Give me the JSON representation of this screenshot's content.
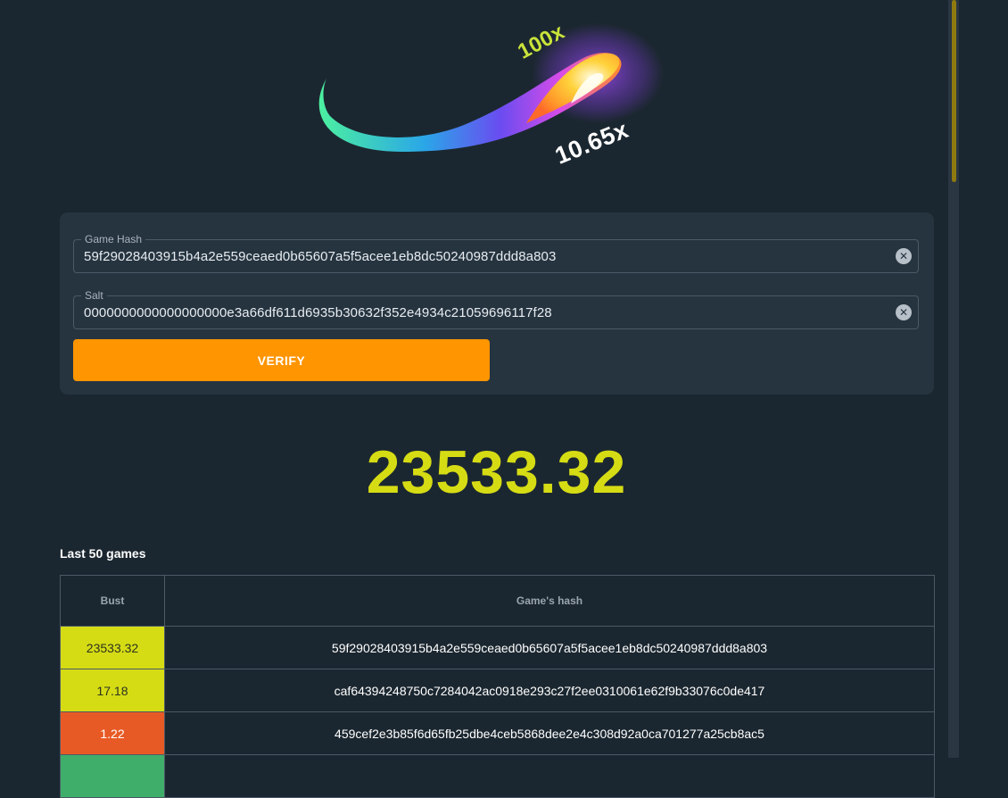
{
  "hero": {
    "label_top": "100x",
    "label_multiplier": "10.65x"
  },
  "form": {
    "game_hash": {
      "label": "Game Hash",
      "value": "59f29028403915b4a2e559ceaed0b65607a5f5acee1eb8dc50240987ddd8a803"
    },
    "salt": {
      "label": "Salt",
      "value": "0000000000000000000e3a66df611d6935b30632f352e4934c21059696117f28"
    },
    "verify_label": "VERIFY"
  },
  "result": {
    "value": "23533.32"
  },
  "games": {
    "title": "Last 50 games",
    "columns": [
      "Bust",
      "Game's hash"
    ],
    "rows": [
      {
        "bust": "23533.32",
        "hash": "59f29028403915b4a2e559ceaed0b65607a5f5acee1eb8dc50240987ddd8a803",
        "status": "yellow"
      },
      {
        "bust": "17.18",
        "hash": "caf64394248750c7284042ac0918e293c27f2ee0310061e62f9b33076c0de417",
        "status": "yellow"
      },
      {
        "bust": "1.22",
        "hash": "459cef2e3b85f6d65fb25dbe4ceb5868dee2e4c308d92a0ca701277a25cb8ac5",
        "status": "red"
      },
      {
        "bust": "",
        "hash": "",
        "status": "green"
      }
    ]
  },
  "colors": {
    "accent_orange": "#ff9500",
    "result_yellow": "#d6dc14",
    "bust_yellow": "#d6dc14",
    "bust_red": "#e85a25",
    "bust_green": "#3fae6b",
    "scroll_thumb": "#8f7a10"
  }
}
